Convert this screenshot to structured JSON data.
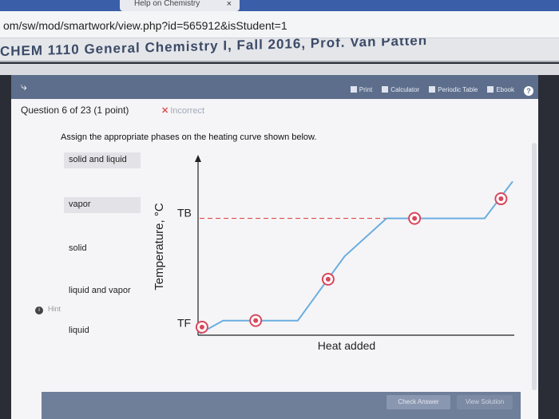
{
  "browser": {
    "tab_title": "Help on Chemistry",
    "tab_close": "×",
    "url": "om/sw/mod/smartwork/view.php?id=565912&isStudent=1",
    "course_banner": "CHEM 1110 General Chemistry I, Fall 2016, Prof. Van Patten"
  },
  "toolbar": {
    "logo": "⤷",
    "print": "Print",
    "calculator": "Calculator",
    "periodic_table": "Periodic Table",
    "ebook": "Ebook",
    "help": "?"
  },
  "question": {
    "title": "Question 6 of 23 (1 point)",
    "status": "Incorrect",
    "status_mark": "✕",
    "prompt": "Assign the appropriate phases on the heating curve shown below."
  },
  "answers": [
    {
      "label": "solid and liquid"
    },
    {
      "label": "vapor"
    },
    {
      "label": "solid"
    },
    {
      "label": "liquid and vapor"
    },
    {
      "label": "liquid"
    }
  ],
  "chart_data": {
    "type": "line",
    "title": "",
    "xlabel": "Heat added",
    "ylabel": "Temperature, °C",
    "ytick_labels": [
      "TB",
      "TF"
    ],
    "points": [
      [
        0,
        0
      ],
      [
        0.5,
        0.6
      ],
      [
        2.1,
        0.6
      ],
      [
        3.1,
        3.55
      ],
      [
        4.0,
        5.3
      ],
      [
        6.1,
        5.3
      ],
      [
        6.7,
        7
      ]
    ],
    "xlim": [
      0,
      6.7
    ],
    "ylim": [
      0,
      8
    ],
    "markers": [
      [
        0.05,
        0.3
      ],
      [
        1.2,
        0.6
      ],
      [
        2.75,
        2.5
      ],
      [
        4.6,
        5.3
      ],
      [
        6.45,
        6.2
      ]
    ],
    "reference_lines": [
      {
        "label": "TB",
        "y": 5.3,
        "style": "dashed",
        "color": "#e04848"
      }
    ],
    "line_color": "#6aaee0",
    "marker_color": "#d8485c"
  },
  "footer": {
    "hint": "Hint",
    "hint_icon": "i",
    "check_answer": "Check Answer",
    "give_up": "View Solution"
  }
}
